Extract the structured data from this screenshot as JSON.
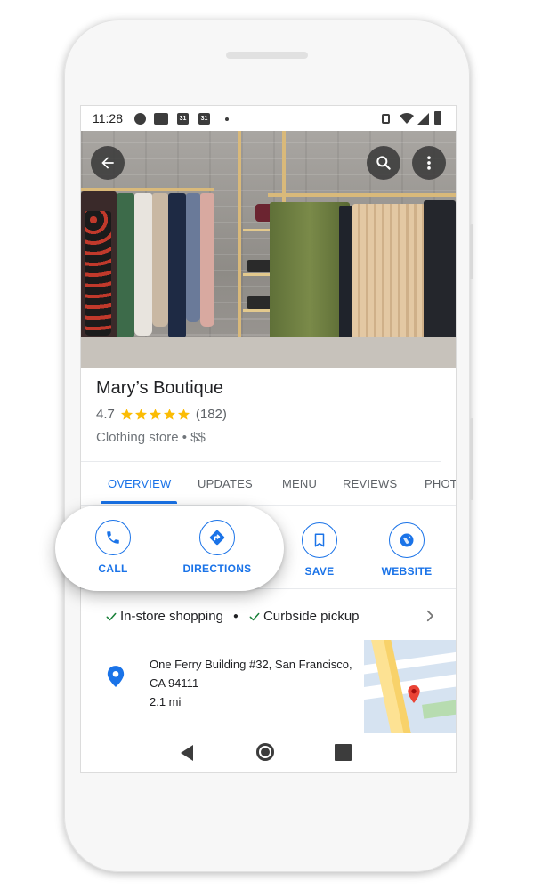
{
  "status_bar": {
    "time": "11:28",
    "calendar_day_1": "31",
    "calendar_day_2": "31"
  },
  "hero": {
    "back_icon": "arrow-back-icon",
    "search_icon": "search-icon",
    "more_icon": "more-vert-icon"
  },
  "place": {
    "name": "Mary’s Boutique",
    "rating": "4.7",
    "stars": 5,
    "review_count": "(182)",
    "category": "Clothing store • $$"
  },
  "tabs": [
    {
      "label": "OVERVIEW",
      "active": true
    },
    {
      "label": "UPDATES",
      "active": false
    },
    {
      "label": "MENU",
      "active": false
    },
    {
      "label": "REVIEWS",
      "active": false
    },
    {
      "label": "PHOT",
      "active": false
    }
  ],
  "actions": {
    "call": "CALL",
    "directions": "DIRECTIONS",
    "save": "SAVE",
    "website": "WEBSITE"
  },
  "features": {
    "item1": "In-store shopping",
    "item2": "Curbside pickup"
  },
  "address": {
    "line1": "One Ferry Building #32, San Francisco,",
    "line2": "CA 94111",
    "distance": "2.1 mi"
  },
  "colors": {
    "accent": "#1a73e8",
    "star": "#fbbc04",
    "check": "#188038",
    "pin": "#ea4335"
  }
}
